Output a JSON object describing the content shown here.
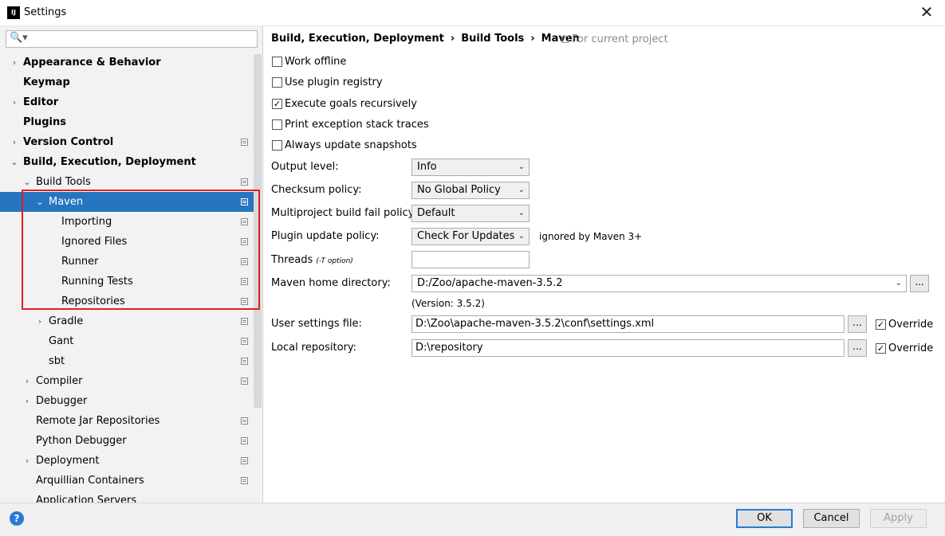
{
  "window": {
    "icon_text": "IJ",
    "title": "Settings",
    "close_symbol": "✕"
  },
  "search": {
    "glyph": "🔍▾",
    "value": ""
  },
  "tree": [
    {
      "label": "Appearance & Behavior",
      "bold": true,
      "arrow": "›"
    },
    {
      "label": "Keymap",
      "bold": true,
      "arrow": ""
    },
    {
      "label": "Editor",
      "bold": true,
      "arrow": "›"
    },
    {
      "label": "Plugins",
      "bold": true,
      "arrow": ""
    },
    {
      "label": "Version Control",
      "bold": true,
      "arrow": "›",
      "copy": true
    },
    {
      "label": "Build, Execution, Deployment",
      "bold": true,
      "arrow": "⌄"
    },
    {
      "label": "Build Tools",
      "arrow": "⌄",
      "copy": true
    },
    {
      "label": "Maven",
      "arrow": "⌄",
      "copy": true,
      "selected": true
    },
    {
      "label": "Importing",
      "copy": true
    },
    {
      "label": "Ignored Files",
      "copy": true
    },
    {
      "label": "Runner",
      "copy": true
    },
    {
      "label": "Running Tests",
      "copy": true
    },
    {
      "label": "Repositories",
      "copy": true
    },
    {
      "label": "Gradle",
      "arrow": "›",
      "copy": true
    },
    {
      "label": "Gant",
      "copy": true
    },
    {
      "label": "sbt",
      "copy": true
    },
    {
      "label": "Compiler",
      "arrow": "›",
      "copy": true
    },
    {
      "label": "Debugger",
      "arrow": "›"
    },
    {
      "label": "Remote Jar Repositories",
      "copy": true
    },
    {
      "label": "Python Debugger",
      "copy": true
    },
    {
      "label": "Deployment",
      "arrow": "›",
      "copy": true
    },
    {
      "label": "Arquillian Containers",
      "copy": true
    },
    {
      "label": "Application Servers"
    }
  ],
  "breadcrumb": {
    "items": [
      "Build, Execution, Deployment",
      "Build Tools",
      "Maven"
    ],
    "separator": "›",
    "scope": "For current project"
  },
  "checkboxes": [
    {
      "label": "Work offline",
      "checked": false
    },
    {
      "label": "Use plugin registry",
      "checked": false
    },
    {
      "label": "Execute goals recursively",
      "checked": true
    },
    {
      "label": "Print exception stack traces",
      "checked": false
    },
    {
      "label": "Always update snapshots",
      "checked": false
    }
  ],
  "check_mark": "✓",
  "fields": {
    "output_level": {
      "label": "Output level:",
      "value": "Info"
    },
    "checksum_policy": {
      "label": "Checksum policy:",
      "value": "No Global Policy"
    },
    "multiproject_fail_policy": {
      "label": "Multiproject build fail policy:",
      "value": "Default"
    },
    "plugin_update_policy": {
      "label": "Plugin update policy:",
      "value": "Check For Updates",
      "hint": "ignored by Maven 3+"
    },
    "threads": {
      "label": "Threads",
      "label_note": "(-T option)",
      "value": ""
    },
    "maven_home": {
      "label": "Maven home directory:",
      "value": "D:/Zoo/apache-maven-3.5.2",
      "version": "(Version: 3.5.2)"
    },
    "user_settings": {
      "label": "User settings file:",
      "value": "D:\\Zoo\\apache-maven-3.5.2\\conf\\settings.xml",
      "override_label": "Override",
      "override": true
    },
    "local_repository": {
      "label": "Local repository:",
      "value": "D:\\repository",
      "override_label": "Override",
      "override": true
    }
  },
  "browse_label": "...",
  "chevron": "⌄",
  "footer": {
    "help": "?",
    "ok": "OK",
    "cancel": "Cancel",
    "apply": "Apply"
  },
  "colors": {
    "selection": "#2675bf",
    "highlight_box": "#e02020",
    "default_button_border": "#2a7ad4"
  }
}
